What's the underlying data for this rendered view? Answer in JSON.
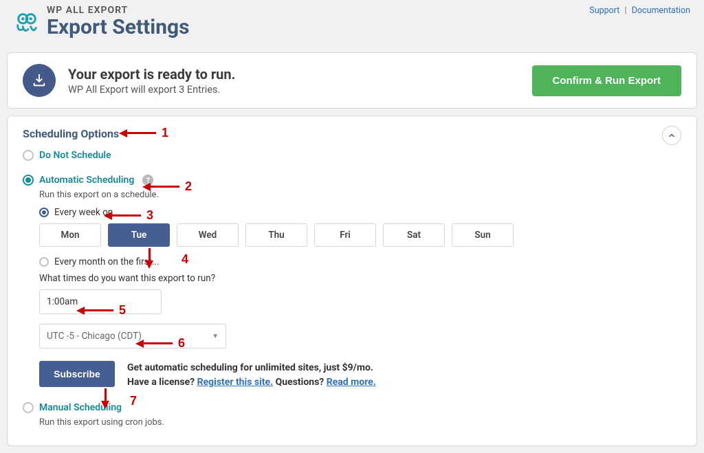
{
  "header": {
    "app_name": "WP ALL EXPORT",
    "page_title": "Export Settings",
    "support": "Support",
    "documentation": "Documentation"
  },
  "ready": {
    "title": "Your export is ready to run.",
    "subtitle": "WP All Export will export 3 Entries.",
    "run_button": "Confirm & Run Export"
  },
  "scheduling": {
    "title": "Scheduling Options",
    "no_schedule": "Do Not Schedule",
    "automatic": "Automatic Scheduling",
    "automatic_desc": "Run this export on a schedule.",
    "every_week": "Every week on...",
    "every_month": "Every month on the first...",
    "days": [
      "Mon",
      "Tue",
      "Wed",
      "Thu",
      "Fri",
      "Sat",
      "Sun"
    ],
    "selected_day_index": 1,
    "time_question": "What times do you want this export to run?",
    "time_value": "1:00am",
    "timezone": "UTC -5 - Chicago (CDT)",
    "subscribe": "Subscribe",
    "promo_line1": "Get automatic scheduling for unlimited sites, just $9/mo.",
    "promo_line2_a": "Have a license? ",
    "promo_register": "Register this site.",
    "promo_line2_b": " Questions? ",
    "promo_readmore": "Read more.",
    "manual": "Manual Scheduling",
    "manual_desc": "Run this export using cron jobs."
  },
  "annotations": [
    "1",
    "2",
    "3",
    "4",
    "5",
    "6",
    "7"
  ]
}
